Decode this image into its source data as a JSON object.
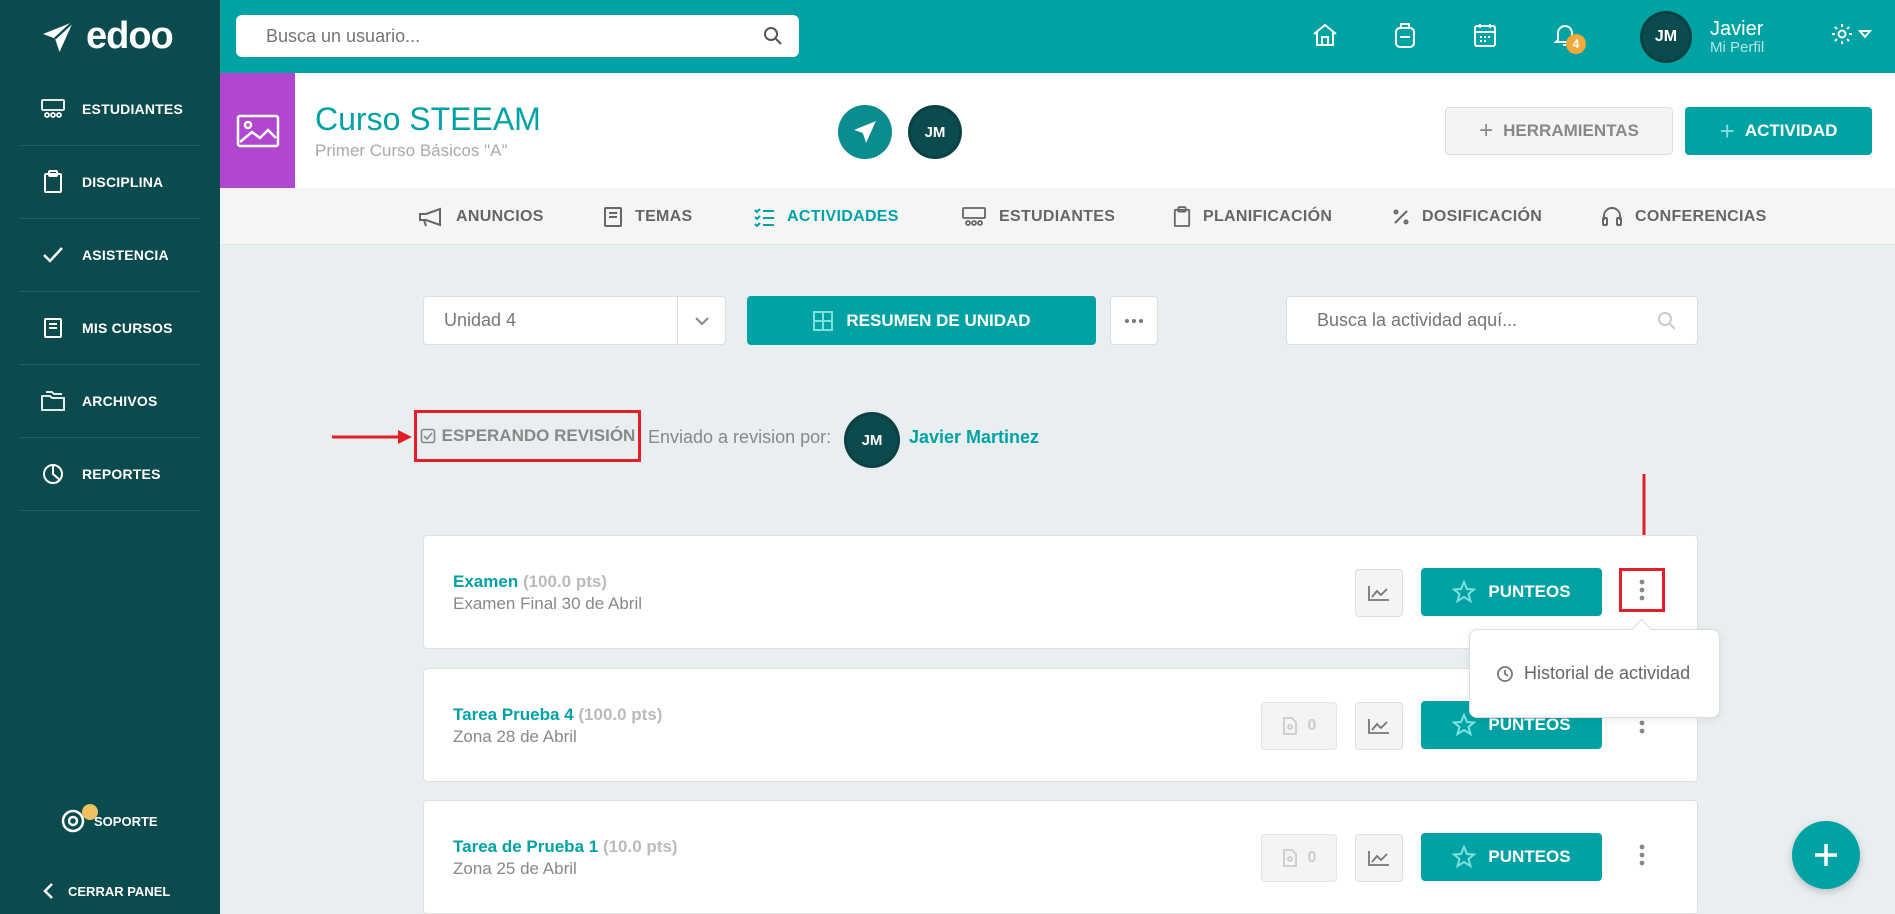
{
  "brand": {
    "name": "edoo"
  },
  "sidebar": {
    "items": [
      {
        "label": "ESTUDIANTES",
        "icon": "students-icon"
      },
      {
        "label": "DISCIPLINA",
        "icon": "clipboard-icon"
      },
      {
        "label": "ASISTENCIA",
        "icon": "check-icon"
      },
      {
        "label": "MIS CURSOS",
        "icon": "book-icon"
      },
      {
        "label": "ARCHIVOS",
        "icon": "folders-icon"
      },
      {
        "label": "REPORTES",
        "icon": "pie-chart-icon"
      }
    ],
    "support_label": "SOPORTE",
    "close_label": "CERRAR PANEL"
  },
  "topbar": {
    "search_placeholder": "Busca un usuario...",
    "notifications_count": "4",
    "profile_initials": "JM",
    "profile_name": "Javier",
    "profile_sub": "Mi Perfil"
  },
  "course": {
    "title": "Curso STEEAM",
    "subtitle": "Primer Curso Básicos \"A\"",
    "member_initials": "JM",
    "tools_label": "HERRAMIENTAS",
    "activity_label": "ACTIVIDAD"
  },
  "tabs": [
    {
      "label": "ANUNCIOS",
      "active": false
    },
    {
      "label": "TEMAS",
      "active": false
    },
    {
      "label": "ACTIVIDADES",
      "active": true
    },
    {
      "label": "ESTUDIANTES",
      "active": false
    },
    {
      "label": "PLANIFICACIÓN",
      "active": false
    },
    {
      "label": "DOSIFICACIÓN",
      "active": false
    },
    {
      "label": "CONFERENCIAS",
      "active": false
    }
  ],
  "toolbar": {
    "unit_value": "Unidad 4",
    "summary_label": "RESUMEN DE UNIDAD",
    "search_placeholder": "Busca la actividad aquí..."
  },
  "review": {
    "status_label": "ESPERANDO REVISIÓN",
    "sent_by_text": "Enviado a revision por:",
    "reviewer_initials": "JM",
    "reviewer_name": "Javier Martinez"
  },
  "activities": [
    {
      "title": "Examen",
      "points": "(100.0 pts)",
      "description": "Examen Final 30 de Abril",
      "files": null,
      "punteos_label": "PUNTEOS"
    },
    {
      "title": "Tarea Prueba 4",
      "points": "(100.0 pts)",
      "description": "Zona 28 de Abril",
      "files": "0",
      "punteos_label": "PUNTEOS"
    },
    {
      "title": "Tarea de Prueba 1",
      "points": "(10.0 pts)",
      "description": "Zona 25 de Abril",
      "files": "0",
      "punteos_label": "PUNTEOS"
    }
  ],
  "dropdown": {
    "item_label": "Historial de actividad"
  },
  "colors": {
    "primary": "#01a2a4",
    "sidebar": "#0c4b4d",
    "course_thumb": "#b147d0",
    "highlight": "#e41e26"
  }
}
